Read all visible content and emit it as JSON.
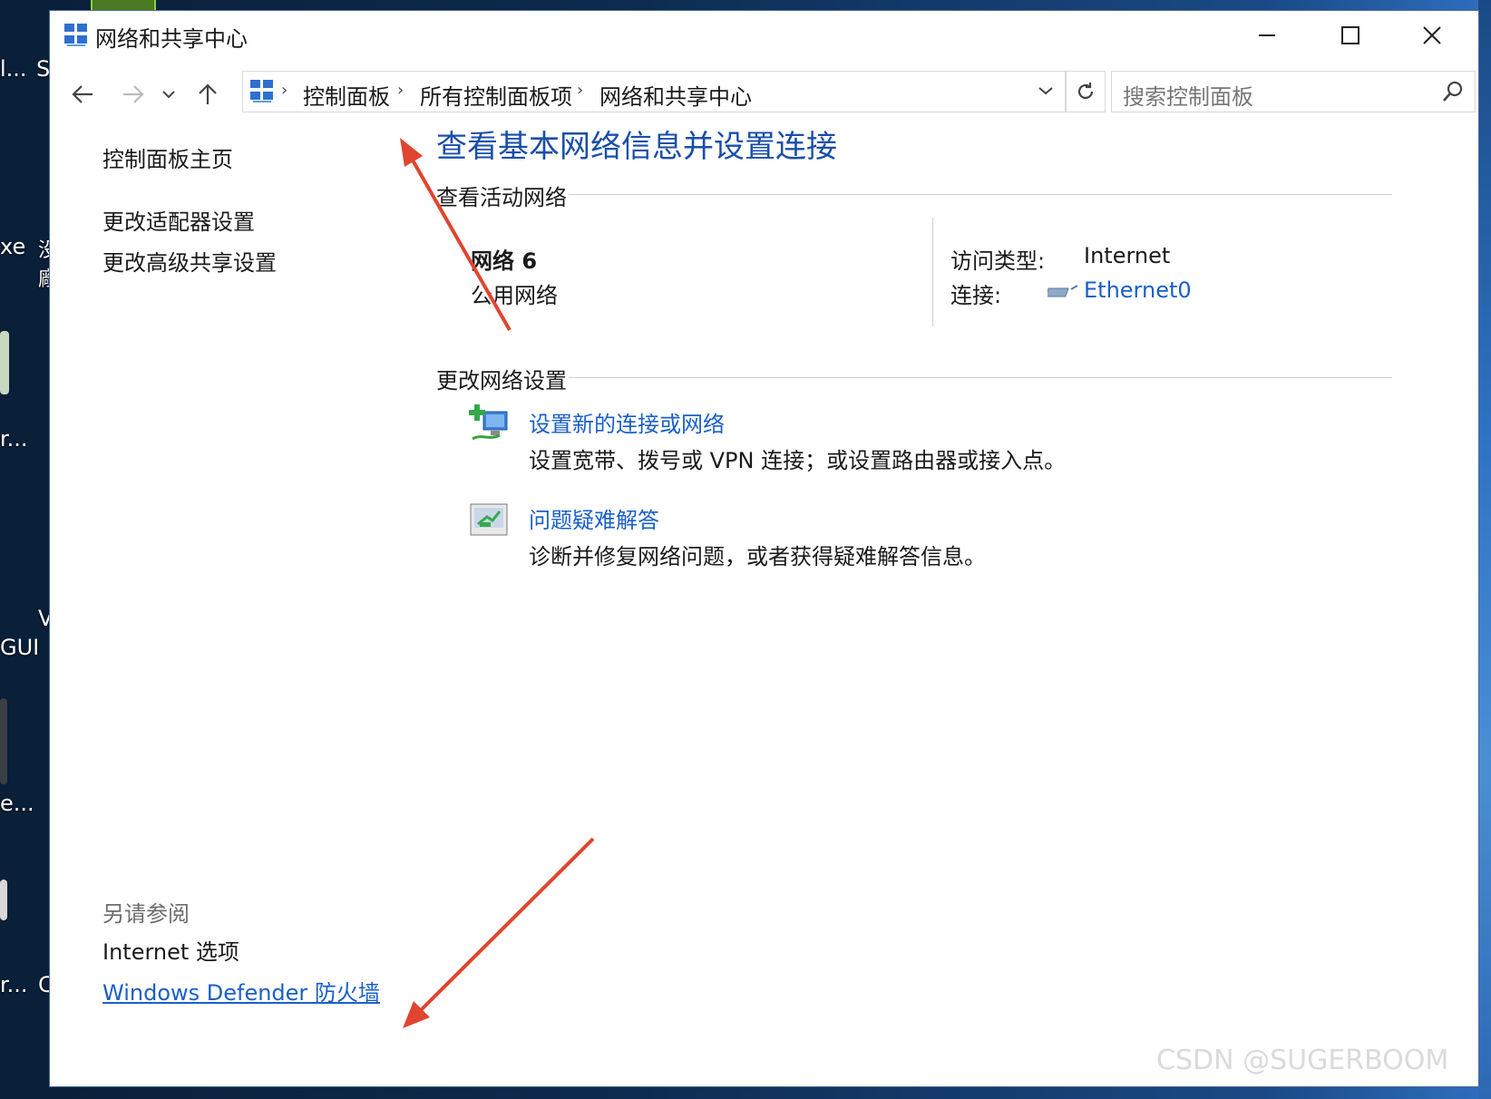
{
  "desktop": {
    "labels": [
      "l...",
      "S",
      "xe",
      "没",
      "廠",
      "r...",
      "V",
      "GUI",
      "e...",
      "r...",
      "C"
    ]
  },
  "window": {
    "title": "网络和共享中心",
    "controls": {
      "minimize": "minimize-icon",
      "maximize": "maximize-icon",
      "close": "close-icon"
    }
  },
  "address": {
    "breadcrumbs": [
      "控制面板",
      "所有控制面板项",
      "网络和共享中心"
    ],
    "search_placeholder": "搜索控制面板"
  },
  "sidebar": {
    "home": "控制面板主页",
    "links": [
      "更改适配器设置",
      "更改高级共享设置"
    ],
    "see_also_title": "另请参阅",
    "see_also": [
      "Internet 选项",
      "Windows Defender 防火墙"
    ]
  },
  "main": {
    "heading": "查看基本网络信息并设置连接",
    "active_section": "查看活动网络",
    "network": {
      "name": "网络 6",
      "category": "公用网络",
      "access_label": "访问类型:",
      "access_value": "Internet",
      "connection_label": "连接:",
      "connection_value": "Ethernet0"
    },
    "change_section": "更改网络设置",
    "tasks": [
      {
        "link": "设置新的连接或网络",
        "desc": "设置宽带、拨号或 VPN 连接；或设置路由器或接入点。"
      },
      {
        "link": "问题疑难解答",
        "desc": "诊断并修复网络问题，或者获得疑难解答信息。"
      }
    ]
  },
  "watermark": "CSDN @SUGERBOOM",
  "colors": {
    "link": "#1a5fc8",
    "heading": "#1a4fa8",
    "annotation_arrow": "#e0452f"
  }
}
